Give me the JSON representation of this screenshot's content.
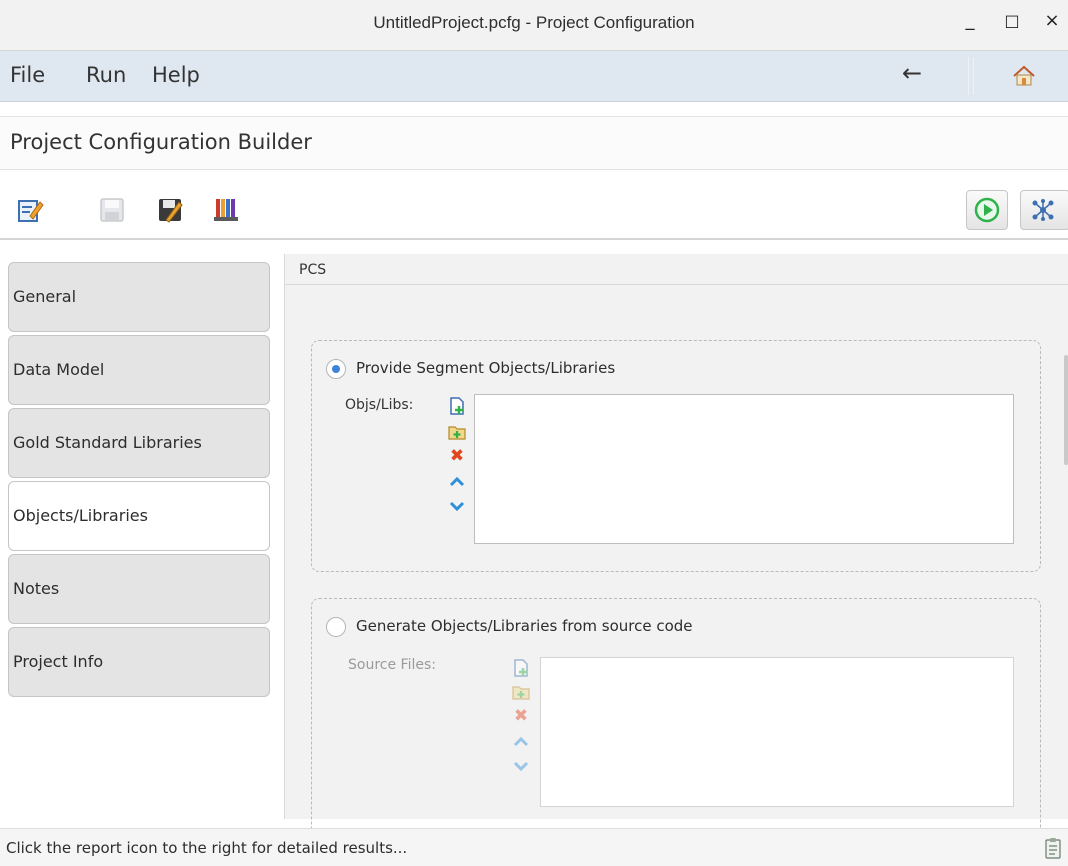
{
  "window": {
    "title": "UntitledProject.pcfg - Project Configuration",
    "minimize": "_",
    "maximize": "□",
    "close": "×"
  },
  "menu": {
    "items": [
      "File",
      "Run",
      "Help"
    ],
    "back_glyph": "←"
  },
  "page": {
    "title": "Project Configuration Builder"
  },
  "tabs": [
    {
      "label": "General"
    },
    {
      "label": "Data Model"
    },
    {
      "label": "Gold Standard Libraries"
    },
    {
      "label": "Objects/Libraries",
      "active": true
    },
    {
      "label": "Notes"
    },
    {
      "label": "Project Info"
    }
  ],
  "panel": {
    "section_title": "PCS",
    "option1": {
      "label": "Provide Segment Objects/Libraries",
      "selected": true,
      "field_label": "Objs/Libs:"
    },
    "option2": {
      "label": "Generate Objects/Libraries from source code",
      "selected": false,
      "field_label": "Source Files:"
    }
  },
  "status": {
    "text": "Click the report icon to the right for detailed results..."
  },
  "icons": {
    "accent": "#3e83d5",
    "run": "#2fb24a",
    "remove": "#e0461f"
  }
}
